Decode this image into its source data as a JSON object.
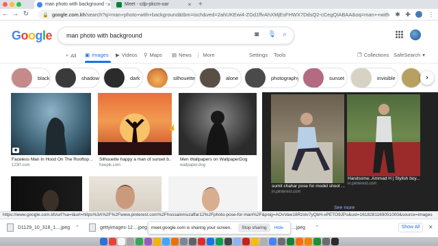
{
  "tabs": [
    {
      "title": "man photo with background -",
      "active": true,
      "favicon_color": "#4285f4"
    },
    {
      "title": "Meet - cdp-pkcm-oar",
      "active": false,
      "favicon_color": "#00832d"
    }
  ],
  "new_tab_symbol": "+",
  "url": {
    "host": "google.com.kh",
    "path": "/search?q=man+photo+with+background&tbm=isch&ved=2ahUKEwi4-ZGd1ffvAhXMjEsFHWX7DdsQ2-cCegQIABAA&oq=man++with+..."
  },
  "google": {
    "logo_letters": [
      {
        "ch": "G",
        "color": "#4285f4"
      },
      {
        "ch": "o",
        "color": "#ea4335"
      },
      {
        "ch": "o",
        "color": "#fbbc05"
      },
      {
        "ch": "g",
        "color": "#4285f4"
      },
      {
        "ch": "l",
        "color": "#34a853"
      },
      {
        "ch": "e",
        "color": "#ea4335"
      }
    ],
    "query": "man photo with background"
  },
  "nav": {
    "all": "All",
    "images": "Images",
    "videos": "Videos",
    "maps": "Maps",
    "news": "News",
    "more": "More",
    "settings": "Settings",
    "tools": "Tools",
    "collections": "Collections",
    "safesearch": "SafeSearch"
  },
  "chips": [
    {
      "label": "black",
      "color": "#c58a8a"
    },
    {
      "label": "shadow",
      "color": "#3a3a3a"
    },
    {
      "label": "dark",
      "color": "#2b2b2b"
    },
    {
      "label": "silhouette",
      "color": "#d9823b"
    },
    {
      "label": "alone",
      "color": "#5a4f44"
    },
    {
      "label": "photography",
      "color": "#4a4a4a"
    },
    {
      "label": "sunset",
      "color": "#b46a80"
    },
    {
      "label": "invisible",
      "color": "#d8d2c4"
    },
    {
      "label": "",
      "color": "#b8a060"
    }
  ],
  "results": [
    {
      "caption": "Faceless Man In Hood On The Rooftop ...",
      "source": "123rf.com"
    },
    {
      "caption": "Silhouette happy a man of sunset b...",
      "source": "freepik.com"
    },
    {
      "caption": "Men Wallpapers on WallpaperDog",
      "source": "wallpaper.dog"
    }
  ],
  "preview": {
    "left_caption": "sumit chahar pose for model shoot ...",
    "left_source": "in.pinterest.com",
    "right_caption": "Handsome..Ammad H | Stylish boy...",
    "right_source": "in.pinterest.com",
    "see_more": "See more",
    "close_symbol": "✕"
  },
  "status_url": "https://www.google.com.kh/url?sa=i&url=https%3A%2F%2Fwww.pinterest.com%2Fhossainmuzaffar12%2Fphoto-pose-for-man%2F&psig=AOvVaw18Rzolv7yQbH-xPETO9JPo&ust=1618281169051000&source=images",
  "downloads": [
    {
      "name": "D1129_10_318_1....jpeg"
    },
    {
      "name": "gettyimages-12....jpeg"
    },
    {
      "name": "...jpeg"
    }
  ],
  "share_bar": {
    "message": "meet.google.com is sharing your screen.",
    "stop": "Stop sharing",
    "hide": "Hide"
  },
  "show_all": "Show All",
  "dock_colors": [
    "#2f6fd6",
    "#e94235",
    "#f5f5f5",
    "#a6a6a6",
    "#34a853",
    "#9b59b6",
    "#f4b400",
    "#3ea6ff",
    "#e8710a",
    "#7b8794",
    "#5f6368",
    "#d93025",
    "#1a73e8",
    "#0f9d58",
    "#444",
    "#8ab4f8",
    "#c5221f",
    "#fbbc04",
    "#b0b0b0",
    "#4285f4",
    "#6d6d6d",
    "#188038",
    "#ff6d00",
    "#ea8600",
    "#1e8e3e",
    "#6c6c6c",
    "#2b2b2b"
  ]
}
